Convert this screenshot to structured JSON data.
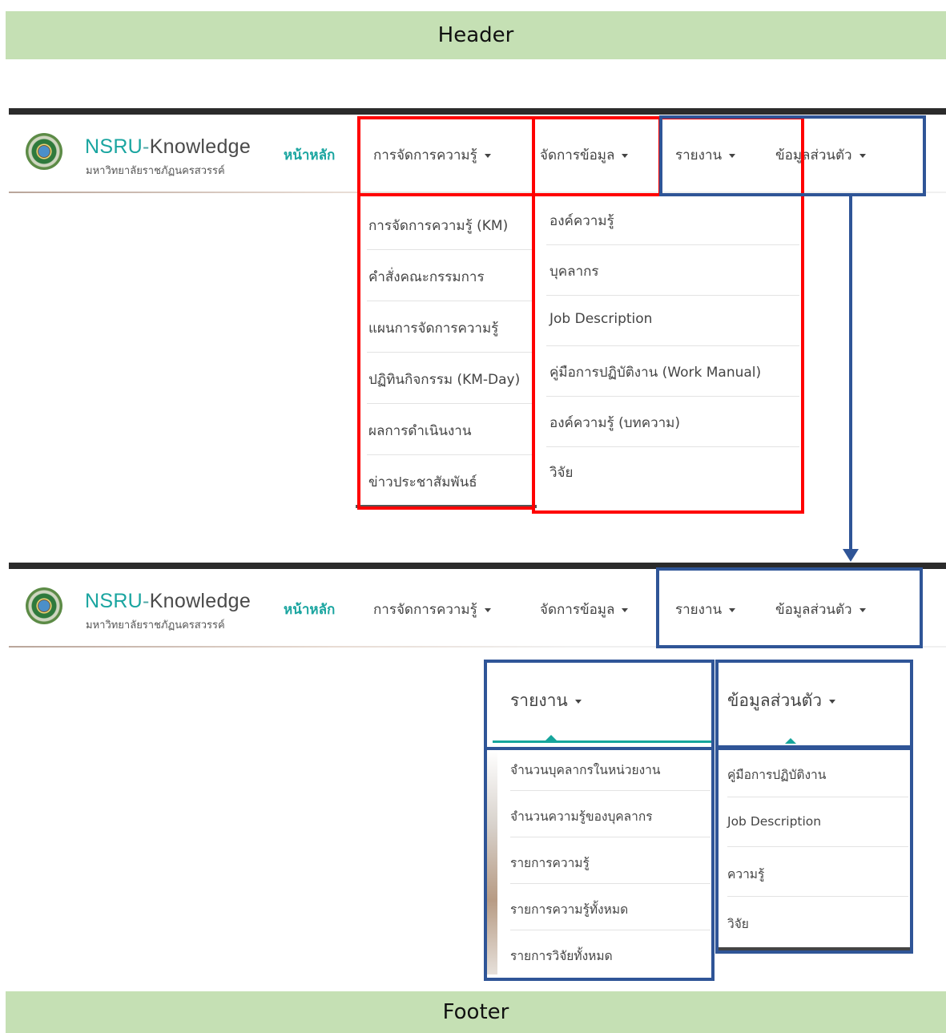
{
  "header": {
    "label": "Header"
  },
  "footer": {
    "label": "Footer"
  },
  "brand": {
    "prefix": "NSRU",
    "dash": "-",
    "name": "Knowledge",
    "tagline": "มหาวิทยาลัยราชภัฏนครสวรรค์"
  },
  "nav": {
    "home": "หน้าหลัก",
    "km": "การจัดการความรู้",
    "data": "จัดการข้อมูล",
    "report": "รายงาน",
    "profile": "ข้อมูลส่วนตัว"
  },
  "km_menu": [
    "การจัดการความรู้ (KM)",
    "คำสั่งคณะกรรมการ",
    "แผนการจัดการความรู้",
    "ปฏิทินกิจกรรม (KM-Day)",
    "ผลการดำเนินงาน",
    "ข่าวประชาสัมพันธ์"
  ],
  "data_menu": [
    "องค์ความรู้",
    "บุคลากร",
    "Job Description",
    "คู่มือการปฏิบัติงาน (Work Manual)",
    "องค์ความรู้ (บทความ)",
    "วิจัย"
  ],
  "report_menu": [
    "จำนวนบุคลากรในหน่วยงาน",
    "จำนวนความรู้ของบุคลากร",
    "รายการความรู้",
    "รายการความรู้ทั้งหมด",
    "รายการวิจัยทั้งหมด"
  ],
  "profile_menu": [
    "คู่มือการปฏิบัติงาน",
    "Job Description",
    "ความรู้",
    "วิจัย"
  ],
  "colors": {
    "annotation_red": "#ff0000",
    "annotation_blue": "#2f5597",
    "band": "#c5e0b4",
    "brand_teal": "#1aa5a0"
  }
}
